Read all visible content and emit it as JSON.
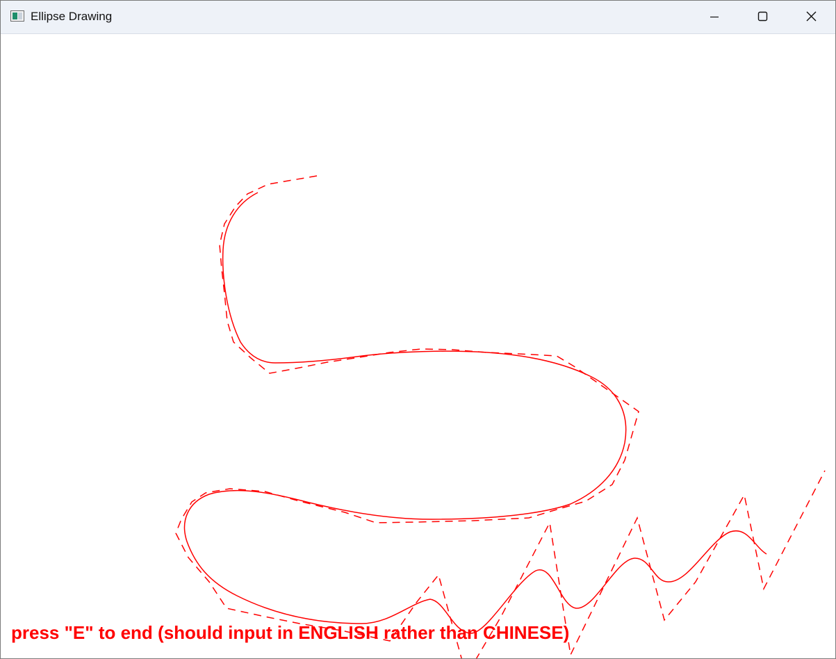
{
  "window": {
    "title": "Ellipse Drawing",
    "icon": "app-window-icon"
  },
  "controls": {
    "minimize_icon": "minimize-icon",
    "maximize_icon": "maximize-icon",
    "close_icon": "close-icon"
  },
  "canvas": {
    "stroke_color": "#ff0000",
    "instructions": "press \"E\" to end (should input in ENGLISH rather than CHINESE)"
  }
}
